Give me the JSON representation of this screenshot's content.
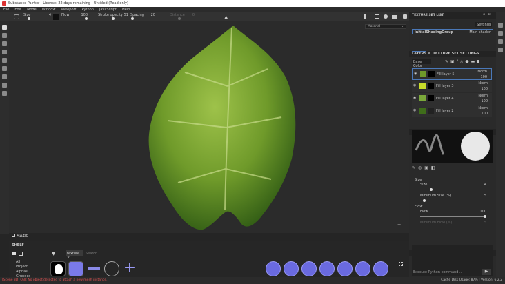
{
  "title": "Substance Painter - License: 22 days remaining - Untitled (Read only)",
  "menu": [
    "File",
    "Edit",
    "Mode",
    "Window",
    "Viewport",
    "Python",
    "JavaScript",
    "Help"
  ],
  "toolbar": {
    "size_label": "Size",
    "size_value": "4",
    "flow_label": "Flow",
    "flow_value": "100",
    "stroke_opacity_label": "Stroke opacity",
    "stroke_opacity_value": "51",
    "spacing_label": "Spacing",
    "spacing_value": "20",
    "distance_label": "Distance",
    "distance_value": "0"
  },
  "viewport": {
    "material_select": "Material",
    "mask_label": "MASK"
  },
  "texture_set_list": {
    "title": "TEXTURE SET LIST",
    "settings": "Settings",
    "item": "initialShadingGroup",
    "shader": "Main shader"
  },
  "layers": {
    "tab1": "LAYERS",
    "tab2": "TEXTURE SET SETTINGS",
    "channel": "Base Color",
    "items": [
      {
        "name": "Fill layer 5",
        "blend": "Norm",
        "opacity": "100",
        "color": "#6f9a2a"
      },
      {
        "name": "Fill layer 3",
        "blend": "Norm",
        "opacity": "100",
        "color": "#c8dc2a"
      },
      {
        "name": "Fill layer 4",
        "blend": "Norm",
        "opacity": "100",
        "color": "#7aa83a"
      },
      {
        "name": "Fill layer 2",
        "blend": "Norm",
        "opacity": "100",
        "color": "#3f6d1a"
      }
    ]
  },
  "properties": {
    "title": "PROPERTIES - PAINT",
    "section_size": "Size",
    "size_label": "Size",
    "size_value": "4",
    "min_size_label": "Minimum Size (%)",
    "min_size_value": "5",
    "section_flow": "Flow",
    "flow_label": "Flow",
    "flow_value": "100",
    "min_flow_label": "Minimum Flow (%)",
    "min_flow_value": "5"
  },
  "python_console": {
    "title": "PYTHON CONSOLE",
    "placeholder": "Execute Python command..."
  },
  "shelf": {
    "title": "SHELF",
    "filter_tag": "texture",
    "search_placeholder": "Search...",
    "categories": [
      "All",
      "Project",
      "Alphas",
      "Grunges"
    ]
  },
  "status": {
    "error": "[Scene 3D] OBJ: No object detected to attach a new mesh instance.",
    "cache": "Cache Disk Usage:  87% | Version: 6.2.2"
  }
}
